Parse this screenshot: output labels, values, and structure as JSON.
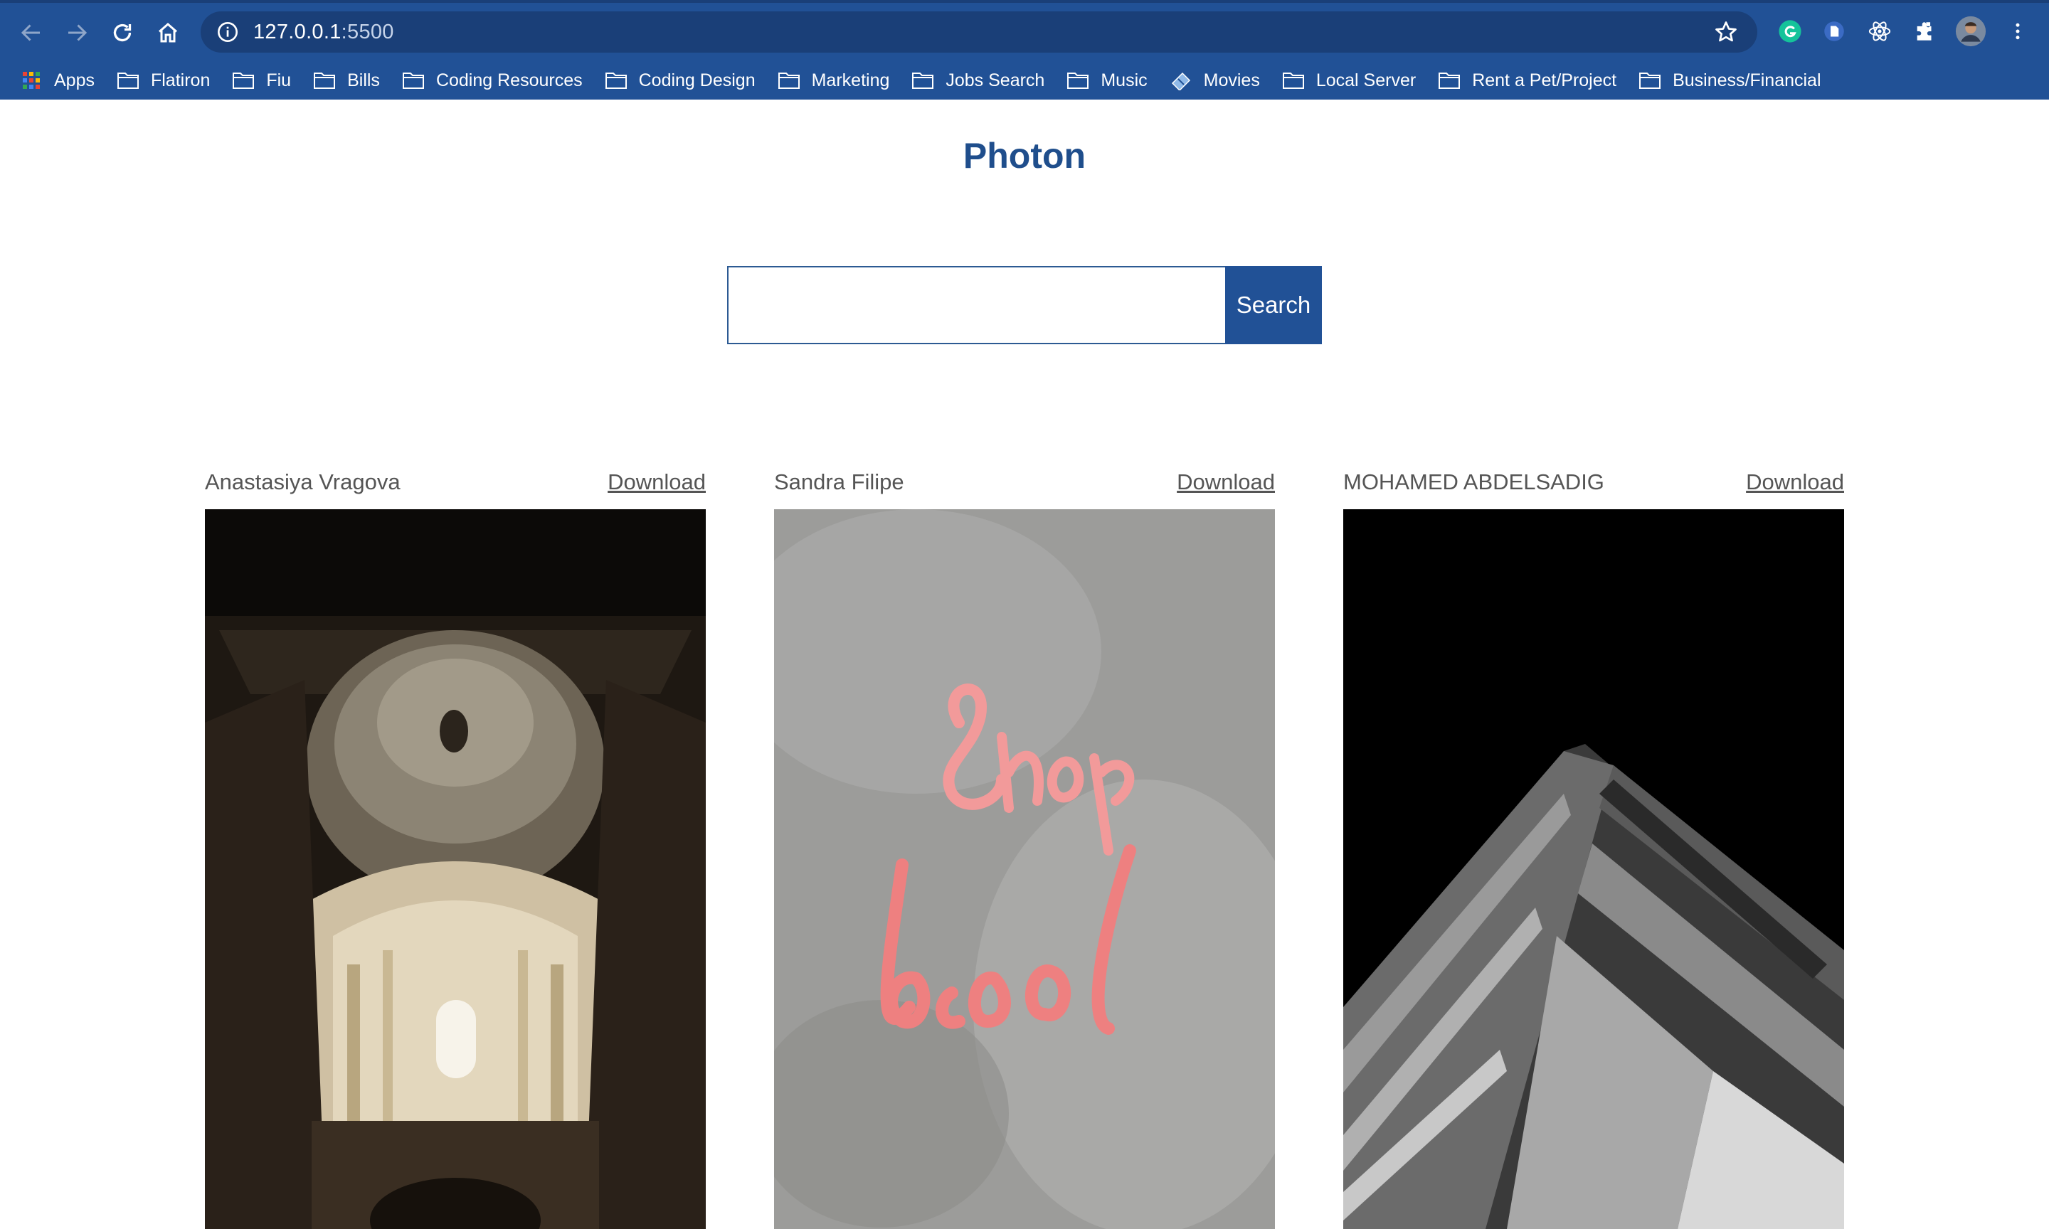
{
  "browser": {
    "url_host": "127.0.0.1",
    "url_port": ":5500",
    "bookmarks": [
      {
        "label": "Apps",
        "icon": "apps-grid-icon"
      },
      {
        "label": "Flatiron",
        "icon": "folder-icon"
      },
      {
        "label": "Fiu",
        "icon": "folder-icon"
      },
      {
        "label": "Bills",
        "icon": "folder-icon"
      },
      {
        "label": "Coding Resources",
        "icon": "folder-icon"
      },
      {
        "label": "Coding Design",
        "icon": "folder-icon"
      },
      {
        "label": "Marketing",
        "icon": "folder-icon"
      },
      {
        "label": "Jobs Search",
        "icon": "folder-icon"
      },
      {
        "label": "Music",
        "icon": "folder-icon"
      },
      {
        "label": "Movies",
        "icon": "ticket-icon"
      },
      {
        "label": "Local Server",
        "icon": "folder-icon"
      },
      {
        "label": "Rent a Pet/Project",
        "icon": "folder-icon"
      },
      {
        "label": "Business/Financial",
        "icon": "folder-icon"
      }
    ],
    "colors": {
      "chrome": "#215196",
      "omnibox": "#1a3f78"
    }
  },
  "page": {
    "title": "Photon",
    "search": {
      "value": "",
      "placeholder": "",
      "button_label": "Search"
    },
    "photos": [
      {
        "author": "Anastasiya Vragova",
        "download_label": "Download",
        "subject": "baroque church dome interior"
      },
      {
        "author": "Sandra Filipe",
        "download_label": "Download",
        "subject": "neon sign on concrete wall"
      },
      {
        "author": "MOHAMED ABDELSADIG",
        "download_label": "Download",
        "subject": "black and white skyscraper"
      }
    ],
    "colors": {
      "title": "#1f4e8c",
      "button": "#215196",
      "text": "#555555"
    }
  }
}
